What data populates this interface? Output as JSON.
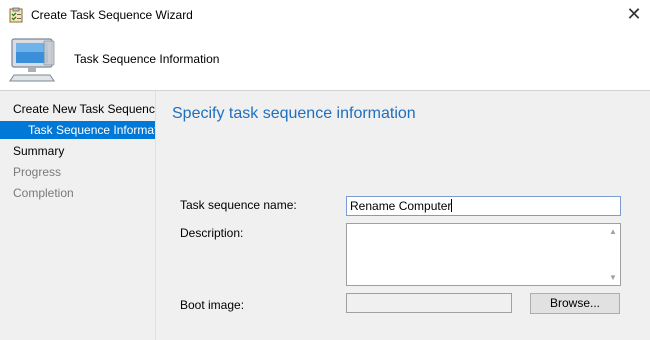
{
  "window": {
    "title": "Create Task Sequence Wizard",
    "close_glyph": "✕",
    "app_icon": "clipboard-checklist-icon"
  },
  "header": {
    "title": "Task Sequence Information",
    "icon": "computer-icon"
  },
  "nav": {
    "items": [
      {
        "label": "Create New Task Sequence",
        "state": "normal"
      },
      {
        "label": "Task Sequence Information",
        "state": "selected"
      },
      {
        "label": "Summary",
        "state": "normal"
      },
      {
        "label": "Progress",
        "state": "disabled"
      },
      {
        "label": "Completion",
        "state": "disabled"
      }
    ]
  },
  "content": {
    "heading": "Specify task sequence information",
    "name_label": "Task sequence name:",
    "name_value": "Rename Computer",
    "description_label": "Description:",
    "description_value": "",
    "boot_image_label": "Boot image:",
    "boot_image_value": "",
    "browse_label": "Browse..."
  },
  "colors": {
    "accent": "#0078d7",
    "heading": "#1e6fbf",
    "panel": "#f0f0f0"
  }
}
